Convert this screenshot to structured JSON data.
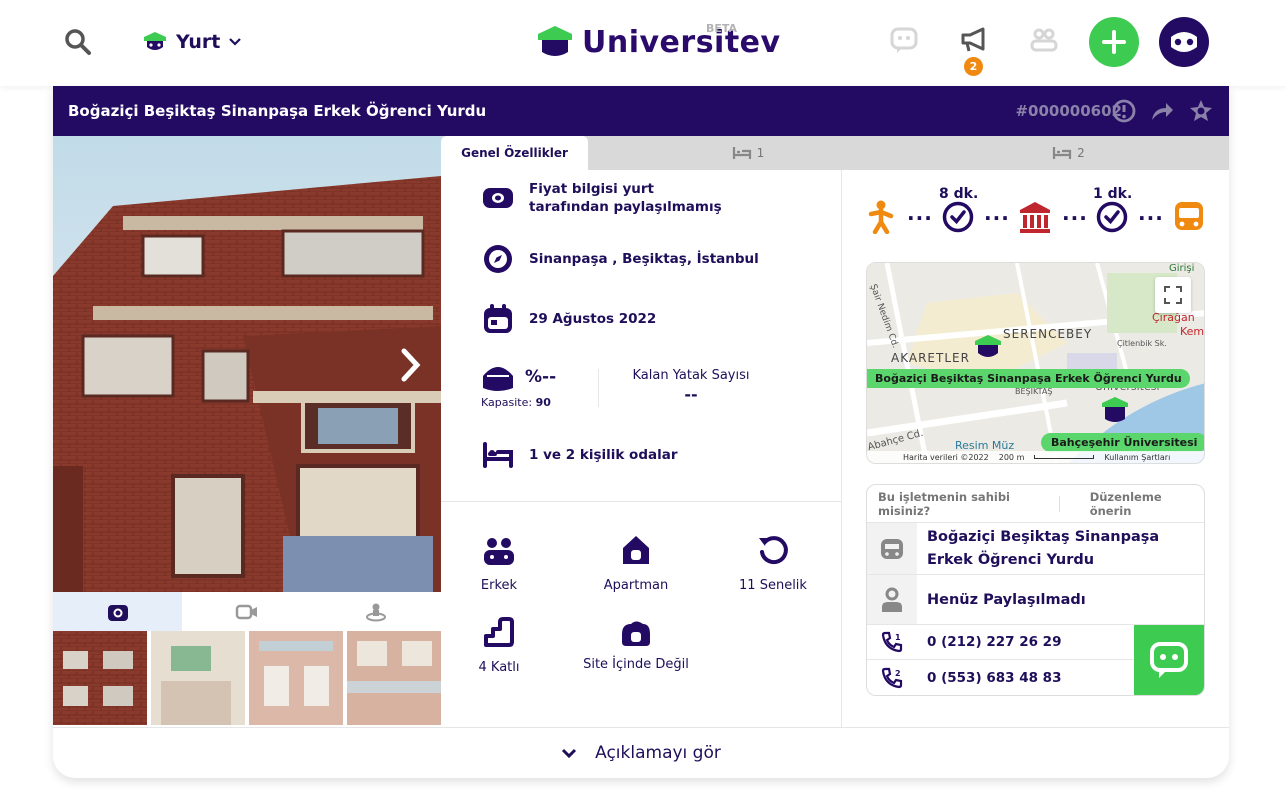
{
  "header": {
    "category_label": "Yurt",
    "brand_name": "Universitev",
    "brand_badge": "BETA",
    "notification_count": "2"
  },
  "listing": {
    "title": "Boğaziçi Beşiktaş Sinanpaşa Erkek Öğrenci Yurdu",
    "id": "#000000602"
  },
  "tabs": [
    {
      "label": "Genel Özellikler"
    },
    {
      "label": "1"
    },
    {
      "label": "2"
    }
  ],
  "info": {
    "price": "Fiyat bilgisi yurt tarafından paylaşılmamış",
    "location": "Sinanpaşa , Beşiktaş, İstanbul",
    "date": "29 Ağustos 2022",
    "occupancy": "%--",
    "capacity_label": "Kapasite:",
    "capacity_value": "90",
    "remaining_beds_label": "Kalan Yatak Sayısı",
    "remaining_beds_value": "--",
    "rooms": "1 ve 2 kişilik odalar"
  },
  "features": [
    {
      "label": "Erkek",
      "icon": "people-icon"
    },
    {
      "label": "Apartman",
      "icon": "building-icon"
    },
    {
      "label": "11 Senelik",
      "icon": "history-icon"
    },
    {
      "label": "4 Katlı",
      "icon": "stairs-icon"
    },
    {
      "label": "Site İçinde Değil",
      "icon": "site-icon"
    }
  ],
  "route": {
    "walk_time": "8 dk.",
    "bus_time": "1 dk."
  },
  "map": {
    "labels": {
      "street1": "Şair Nedim Cd.",
      "district1": "SERENCEBEY",
      "district2": "AKARETLER",
      "street2": "Çitlenbik Sk.",
      "place1": "Çırağan",
      "place2": "Kem",
      "place3": "Girişi",
      "place4": "BEŞİKTAŞ",
      "street3": "Abahçe Cd.",
      "place5": "Resim Müz",
      "uni_partial": "Bahçeşehir Üniversitesi"
    },
    "pin_dorm": "Boğaziçi Beşiktaş Sinanpaşa Erkek Öğrenci Yurdu",
    "pin_uni": "Bahçeşehir Üniversitesi",
    "footer_data": "Harita verileri ©2022",
    "footer_scale": "200 m",
    "footer_terms": "Kullanım Şartları"
  },
  "owner": {
    "question": "Bu işletmenin sahibi misiniz?",
    "suggest": "Düzenleme önerin",
    "name": "Boğaziçi Beşiktaş Sinanpaşa Erkek Öğrenci Yurdu",
    "manager": "Henüz Paylaşılmadı",
    "phone1": "0 (212) 227 26 29",
    "phone2": "0 (553) 683 48 83"
  },
  "footer": {
    "expand_label": "Açıklamayı gör"
  },
  "colors": {
    "primary": "#230a63",
    "accent_green": "#3dcb52",
    "orange": "#f0890f",
    "red": "#c0262d"
  }
}
